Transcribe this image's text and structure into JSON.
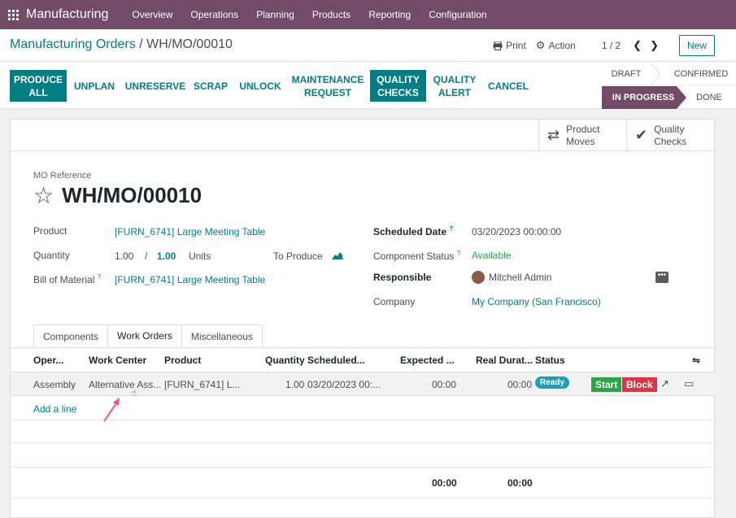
{
  "navbar": {
    "brand": "Manufacturing",
    "items": [
      "Overview",
      "Operations",
      "Planning",
      "Products",
      "Reporting",
      "Configuration"
    ]
  },
  "control_panel": {
    "breadcrumb_parent": "Manufacturing Orders",
    "breadcrumb_separator": "/",
    "breadcrumb_current": "WH/MO/00010",
    "print_label": "Print",
    "action_label": "Action",
    "pager": "1 / 2",
    "new_label": "New"
  },
  "action_buttons": {
    "produce_all_1": "PRODUCE",
    "produce_all_2": "ALL",
    "unplan": "UNPLAN",
    "unreserve": "UNRESERVE",
    "scrap": "SCRAP",
    "unlock": "UNLOCK",
    "maintenance_1": "MAINTENANCE",
    "maintenance_2": "REQUEST",
    "quality_checks_1": "QUALITY",
    "quality_checks_2": "CHECKS",
    "quality_alert_1": "QUALITY",
    "quality_alert_2": "ALERT",
    "cancel": "CANCEL"
  },
  "status_stages": {
    "draft": "DRAFT",
    "confirmed": "CONFIRMED",
    "in_progress": "IN PROGRESS",
    "done": "DONE"
  },
  "smart_buttons": {
    "product_moves_1": "Product",
    "product_moves_2": "Moves",
    "quality_checks_1": "Quality",
    "quality_checks_2": "Checks"
  },
  "form": {
    "mo_reference_label": "MO Reference",
    "mo_reference": "WH/MO/00010",
    "product_label": "Product",
    "product": "[FURN_6741] Large Meeting Table",
    "quantity_label": "Quantity",
    "quantity_done": "1.00",
    "quantity_sep": "/",
    "quantity_total": "1.00",
    "quantity_uom": "Units",
    "to_produce_label": "To Produce",
    "bom_label": "Bill of Material",
    "bom": "[FURN_6741] Large Meeting Table",
    "scheduled_date_label": "Scheduled Date",
    "scheduled_date": "03/20/2023 00:00:00",
    "component_status_label": "Component Status",
    "component_status": "Available",
    "responsible_label": "Responsible",
    "responsible": "Mitchell Admin",
    "company_label": "Company",
    "company": "My Company (San Francisco)",
    "help_mark": "?"
  },
  "tabs": [
    "Components",
    "Work Orders",
    "Miscellaneous"
  ],
  "work_orders": {
    "columns": {
      "operation": "Oper...",
      "work_center": "Work Center",
      "product": "Product",
      "quantity": "Quantity",
      "scheduled": "Scheduled...",
      "expected": "Expected ...",
      "real_duration": "Real Durat...",
      "status": "Status"
    },
    "row": {
      "operation": "Assembly",
      "work_center": "Alternative Ass...",
      "product": "[FURN_6741] L...",
      "quantity": "1.00",
      "scheduled": "03/20/2023 00:...",
      "expected": "00:00",
      "real_duration": "00:00",
      "status": "Ready",
      "start_label": "Start",
      "block_label": "Block"
    },
    "add_line": "Add a line",
    "total_expected": "00:00",
    "total_real": "00:00"
  },
  "colors": {
    "brand": "#714b67",
    "primary": "#017e84",
    "success": "#28a745",
    "danger": "#dc3545",
    "info": "#17a2b8"
  }
}
